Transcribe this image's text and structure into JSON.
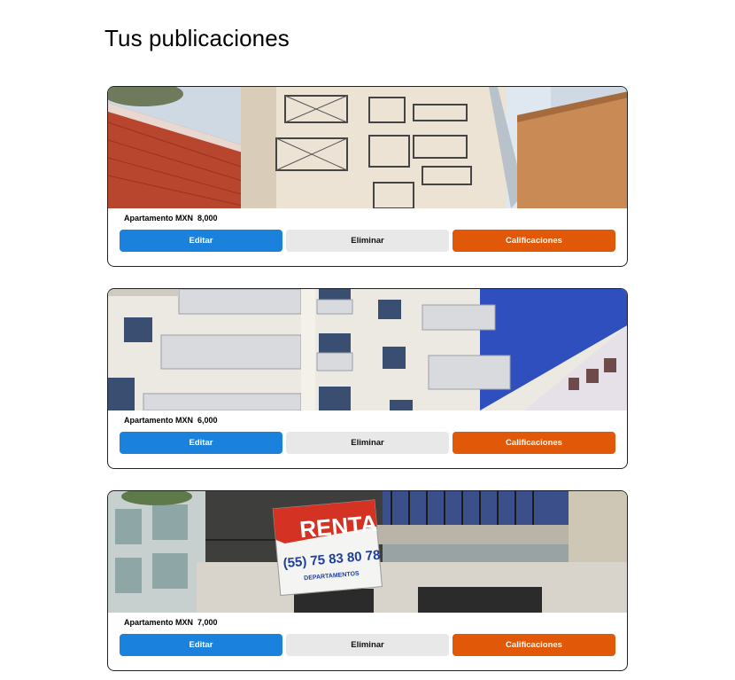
{
  "page": {
    "title": "Tus publicaciones"
  },
  "listings": [
    {
      "info": "Apartamento MXN  8,000",
      "image_alt": "apartment-building-photo"
    },
    {
      "info": "Apartamento MXN  6,000",
      "image_alt": "apartment-building-photo"
    },
    {
      "info": "Apartamento MXN  7,000",
      "image_alt": "renta-sign-building-photo",
      "sign": {
        "word": "RENTA",
        "phone": "(55) 75 83 80 78",
        "caption": "DEPARTAMENTOS"
      }
    }
  ],
  "buttons": {
    "edit": "Editar",
    "delete": "Eliminar",
    "ratings": "Calificaciones"
  },
  "colors": {
    "edit": "#1a82dc",
    "delete": "#e8e8e8",
    "ratings": "#e05808"
  }
}
